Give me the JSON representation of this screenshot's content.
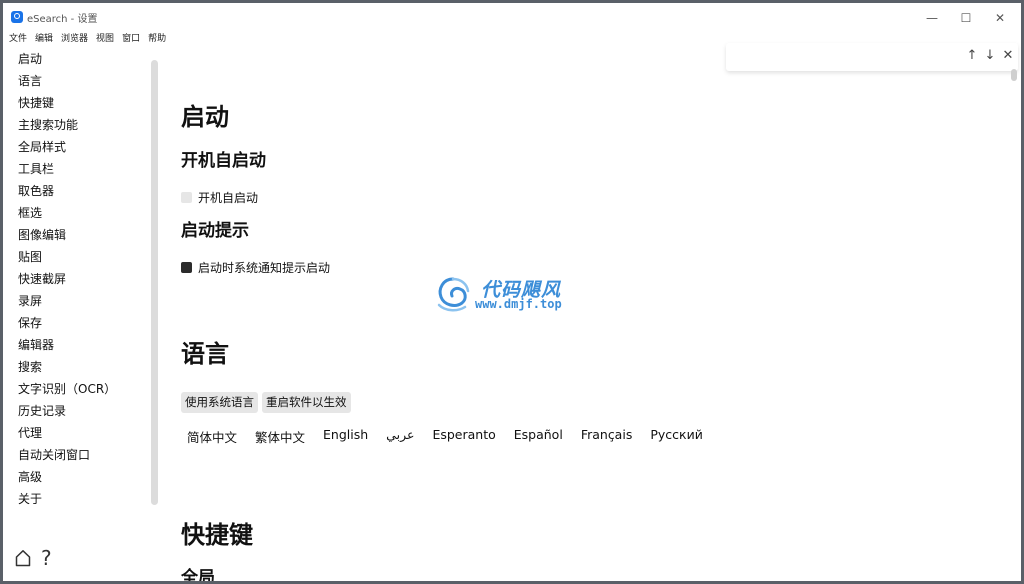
{
  "window": {
    "title": "eSearch - 设置",
    "controls": {
      "minimize": "—",
      "maximize": "☐",
      "close": "✕"
    }
  },
  "menubar": [
    "文件",
    "编辑",
    "浏览器",
    "视图",
    "窗口",
    "帮助"
  ],
  "sidebar": {
    "items": [
      "启动",
      "语言",
      "快捷键",
      "主搜索功能",
      "全局样式",
      "工具栏",
      "取色器",
      "框选",
      "图像编辑",
      "贴图",
      "快速截屏",
      "录屏",
      "保存",
      "编辑器",
      "搜索",
      "文字识别（OCR）",
      "历史记录",
      "代理",
      "自动关闭窗口",
      "高级",
      "关于"
    ],
    "bottom_icons": [
      "home-icon",
      "help-icon"
    ],
    "help_glyph": "?"
  },
  "findbar": {
    "up": "↑",
    "down": "↓",
    "close": "✕"
  },
  "main": {
    "startup": {
      "title": "启动",
      "autostart_heading": "开机自启动",
      "autostart_label": "开机自启动",
      "autostart_checked": false,
      "notify_heading": "启动提示",
      "notify_label": "启动时系统通知提示启动",
      "notify_checked": true
    },
    "language": {
      "title": "语言",
      "buttons": [
        "使用系统语言",
        "重启软件以生效"
      ],
      "options": [
        "简体中文",
        "繁体中文",
        "English",
        "عربي",
        "Esperanto",
        "Español",
        "Français",
        "Русский"
      ]
    },
    "shortcuts": {
      "title": "快捷键",
      "sub_heading_partial": "全局"
    }
  },
  "watermark": {
    "title": "代码飓风",
    "url": "www.dmjf.top"
  },
  "colors": {
    "accent": "#1a73e8",
    "watermark": "#3d8ed8",
    "checkbox_on": "#2b2b2b",
    "checkbox_off": "#e6e6e6"
  }
}
